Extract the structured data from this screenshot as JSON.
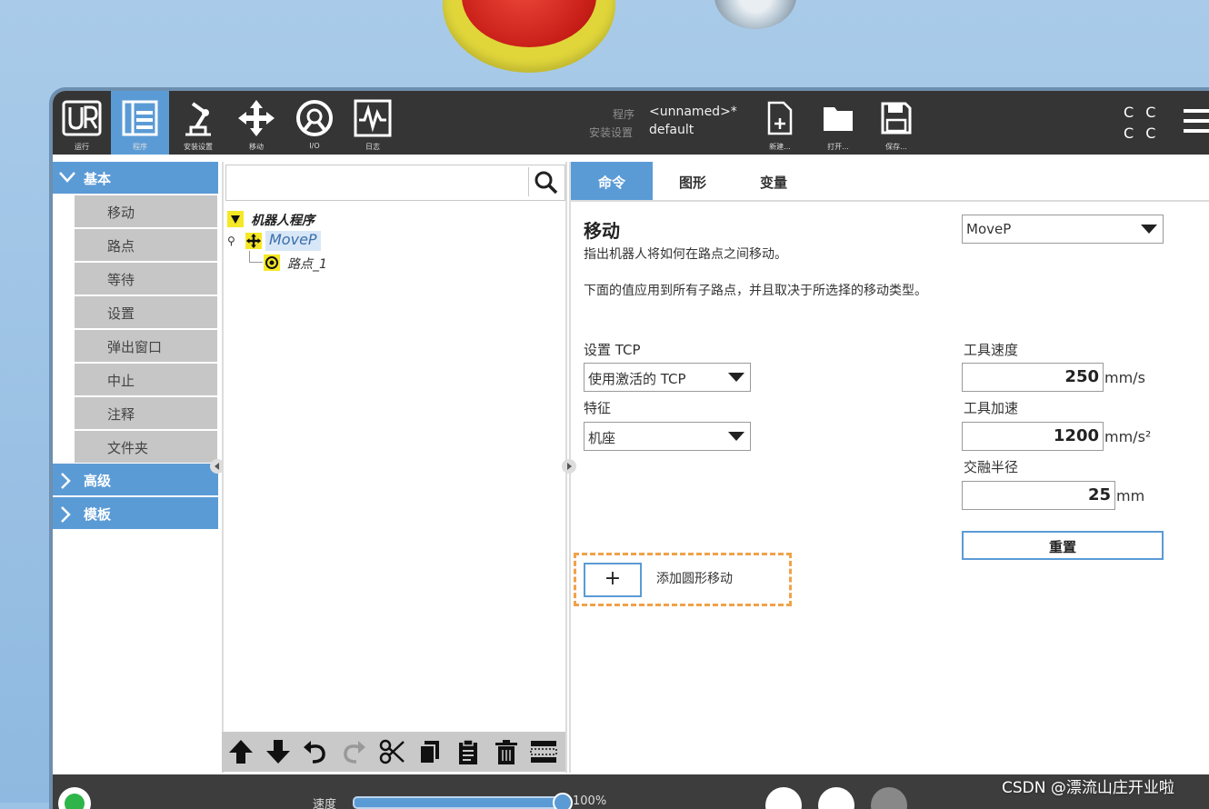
{
  "topbar": {
    "buttons": [
      {
        "label": "运行"
      },
      {
        "label": "程序"
      },
      {
        "label": "安装设置"
      },
      {
        "label": "移动"
      },
      {
        "label": "I/O"
      },
      {
        "label": "日志"
      }
    ],
    "program_key": "程序",
    "program_value": "<unnamed>*",
    "install_key": "安装设置",
    "install_value": "default",
    "file_buttons": [
      {
        "label": "新建..."
      },
      {
        "label": "打开..."
      },
      {
        "label": "保存..."
      }
    ],
    "cc_text": "C C"
  },
  "sidebar": {
    "basic": "基本",
    "items": [
      "移动",
      "路点",
      "等待",
      "设置",
      "弹出窗口",
      "中止",
      "注释",
      "文件夹"
    ],
    "advanced": "高级",
    "templates": "模板"
  },
  "tree": {
    "root": "机器人程序",
    "node1": "MoveP",
    "node2": "路点_1"
  },
  "tabs": [
    "命令",
    "图形",
    "变量"
  ],
  "command": {
    "title": "移动",
    "move_type": "MoveP",
    "desc1": "指出机器人将如何在路点之间移动。",
    "desc2": "下面的值应用到所有子路点，并且取决于所选择的移动类型。",
    "tcp_label": "设置 TCP",
    "tcp_value": "使用激活的 TCP",
    "feature_label": "特征",
    "feature_value": "机座",
    "speed_label": "工具速度",
    "speed_value": "250",
    "speed_unit": "mm/s",
    "accel_label": "工具加速",
    "accel_value": "1200",
    "accel_unit": "mm/s²",
    "blend_label": "交融半径",
    "blend_value": "25",
    "blend_unit": "mm",
    "reset_label": "重置",
    "add_circle_plus": "+",
    "add_circle_label": "添加圆形移动"
  },
  "bottom": {
    "speed_label": "速度",
    "speed_percent": "100%"
  },
  "watermark": "CSDN @漂流山庄开业啦",
  "colors": {
    "accent": "#5b9bd5",
    "topbar": "#353535",
    "highlight_orange": "#f0a24a",
    "tree_icon_yellow": "#f5e826"
  }
}
